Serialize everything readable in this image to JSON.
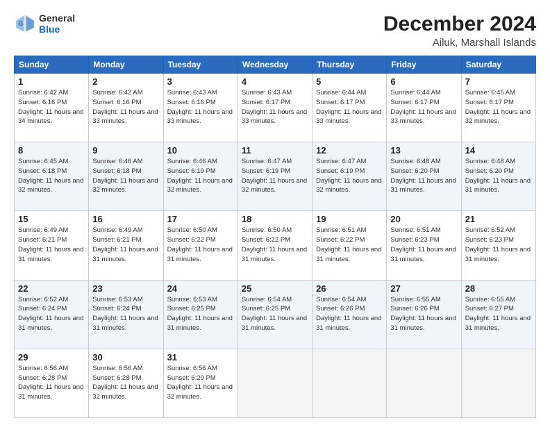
{
  "header": {
    "logo_line1": "General",
    "logo_line2": "Blue",
    "title": "December 2024",
    "subtitle": "Ailuk, Marshall Islands"
  },
  "columns": [
    "Sunday",
    "Monday",
    "Tuesday",
    "Wednesday",
    "Thursday",
    "Friday",
    "Saturday"
  ],
  "weeks": [
    [
      {
        "day": "1",
        "sunrise": "Sunrise: 6:42 AM",
        "sunset": "Sunset: 6:16 PM",
        "daylight": "Daylight: 11 hours and 34 minutes."
      },
      {
        "day": "2",
        "sunrise": "Sunrise: 6:42 AM",
        "sunset": "Sunset: 6:16 PM",
        "daylight": "Daylight: 11 hours and 33 minutes."
      },
      {
        "day": "3",
        "sunrise": "Sunrise: 6:43 AM",
        "sunset": "Sunset: 6:16 PM",
        "daylight": "Daylight: 11 hours and 33 minutes."
      },
      {
        "day": "4",
        "sunrise": "Sunrise: 6:43 AM",
        "sunset": "Sunset: 6:17 PM",
        "daylight": "Daylight: 11 hours and 33 minutes."
      },
      {
        "day": "5",
        "sunrise": "Sunrise: 6:44 AM",
        "sunset": "Sunset: 6:17 PM",
        "daylight": "Daylight: 11 hours and 33 minutes."
      },
      {
        "day": "6",
        "sunrise": "Sunrise: 6:44 AM",
        "sunset": "Sunset: 6:17 PM",
        "daylight": "Daylight: 11 hours and 33 minutes."
      },
      {
        "day": "7",
        "sunrise": "Sunrise: 6:45 AM",
        "sunset": "Sunset: 6:17 PM",
        "daylight": "Daylight: 11 hours and 32 minutes."
      }
    ],
    [
      {
        "day": "8",
        "sunrise": "Sunrise: 6:45 AM",
        "sunset": "Sunset: 6:18 PM",
        "daylight": "Daylight: 11 hours and 32 minutes."
      },
      {
        "day": "9",
        "sunrise": "Sunrise: 6:46 AM",
        "sunset": "Sunset: 6:18 PM",
        "daylight": "Daylight: 11 hours and 32 minutes."
      },
      {
        "day": "10",
        "sunrise": "Sunrise: 6:46 AM",
        "sunset": "Sunset: 6:19 PM",
        "daylight": "Daylight: 11 hours and 32 minutes."
      },
      {
        "day": "11",
        "sunrise": "Sunrise: 6:47 AM",
        "sunset": "Sunset: 6:19 PM",
        "daylight": "Daylight: 11 hours and 32 minutes."
      },
      {
        "day": "12",
        "sunrise": "Sunrise: 6:47 AM",
        "sunset": "Sunset: 6:19 PM",
        "daylight": "Daylight: 11 hours and 32 minutes."
      },
      {
        "day": "13",
        "sunrise": "Sunrise: 6:48 AM",
        "sunset": "Sunset: 6:20 PM",
        "daylight": "Daylight: 11 hours and 31 minutes."
      },
      {
        "day": "14",
        "sunrise": "Sunrise: 6:48 AM",
        "sunset": "Sunset: 6:20 PM",
        "daylight": "Daylight: 11 hours and 31 minutes."
      }
    ],
    [
      {
        "day": "15",
        "sunrise": "Sunrise: 6:49 AM",
        "sunset": "Sunset: 6:21 PM",
        "daylight": "Daylight: 11 hours and 31 minutes."
      },
      {
        "day": "16",
        "sunrise": "Sunrise: 6:49 AM",
        "sunset": "Sunset: 6:21 PM",
        "daylight": "Daylight: 11 hours and 31 minutes."
      },
      {
        "day": "17",
        "sunrise": "Sunrise: 6:50 AM",
        "sunset": "Sunset: 6:22 PM",
        "daylight": "Daylight: 11 hours and 31 minutes."
      },
      {
        "day": "18",
        "sunrise": "Sunrise: 6:50 AM",
        "sunset": "Sunset: 6:22 PM",
        "daylight": "Daylight: 11 hours and 31 minutes."
      },
      {
        "day": "19",
        "sunrise": "Sunrise: 6:51 AM",
        "sunset": "Sunset: 6:22 PM",
        "daylight": "Daylight: 11 hours and 31 minutes."
      },
      {
        "day": "20",
        "sunrise": "Sunrise: 6:51 AM",
        "sunset": "Sunset: 6:23 PM",
        "daylight": "Daylight: 11 hours and 31 minutes."
      },
      {
        "day": "21",
        "sunrise": "Sunrise: 6:52 AM",
        "sunset": "Sunset: 6:23 PM",
        "daylight": "Daylight: 11 hours and 31 minutes."
      }
    ],
    [
      {
        "day": "22",
        "sunrise": "Sunrise: 6:52 AM",
        "sunset": "Sunset: 6:24 PM",
        "daylight": "Daylight: 11 hours and 31 minutes."
      },
      {
        "day": "23",
        "sunrise": "Sunrise: 6:53 AM",
        "sunset": "Sunset: 6:24 PM",
        "daylight": "Daylight: 11 hours and 31 minutes."
      },
      {
        "day": "24",
        "sunrise": "Sunrise: 6:53 AM",
        "sunset": "Sunset: 6:25 PM",
        "daylight": "Daylight: 11 hours and 31 minutes."
      },
      {
        "day": "25",
        "sunrise": "Sunrise: 6:54 AM",
        "sunset": "Sunset: 6:25 PM",
        "daylight": "Daylight: 11 hours and 31 minutes."
      },
      {
        "day": "26",
        "sunrise": "Sunrise: 6:54 AM",
        "sunset": "Sunset: 6:26 PM",
        "daylight": "Daylight: 11 hours and 31 minutes."
      },
      {
        "day": "27",
        "sunrise": "Sunrise: 6:55 AM",
        "sunset": "Sunset: 6:26 PM",
        "daylight": "Daylight: 11 hours and 31 minutes."
      },
      {
        "day": "28",
        "sunrise": "Sunrise: 6:55 AM",
        "sunset": "Sunset: 6:27 PM",
        "daylight": "Daylight: 11 hours and 31 minutes."
      }
    ],
    [
      {
        "day": "29",
        "sunrise": "Sunrise: 6:56 AM",
        "sunset": "Sunset: 6:28 PM",
        "daylight": "Daylight: 11 hours and 31 minutes."
      },
      {
        "day": "30",
        "sunrise": "Sunrise: 6:56 AM",
        "sunset": "Sunset: 6:28 PM",
        "daylight": "Daylight: 11 hours and 32 minutes."
      },
      {
        "day": "31",
        "sunrise": "Sunrise: 6:56 AM",
        "sunset": "Sunset: 6:29 PM",
        "daylight": "Daylight: 11 hours and 32 minutes."
      },
      null,
      null,
      null,
      null
    ]
  ]
}
